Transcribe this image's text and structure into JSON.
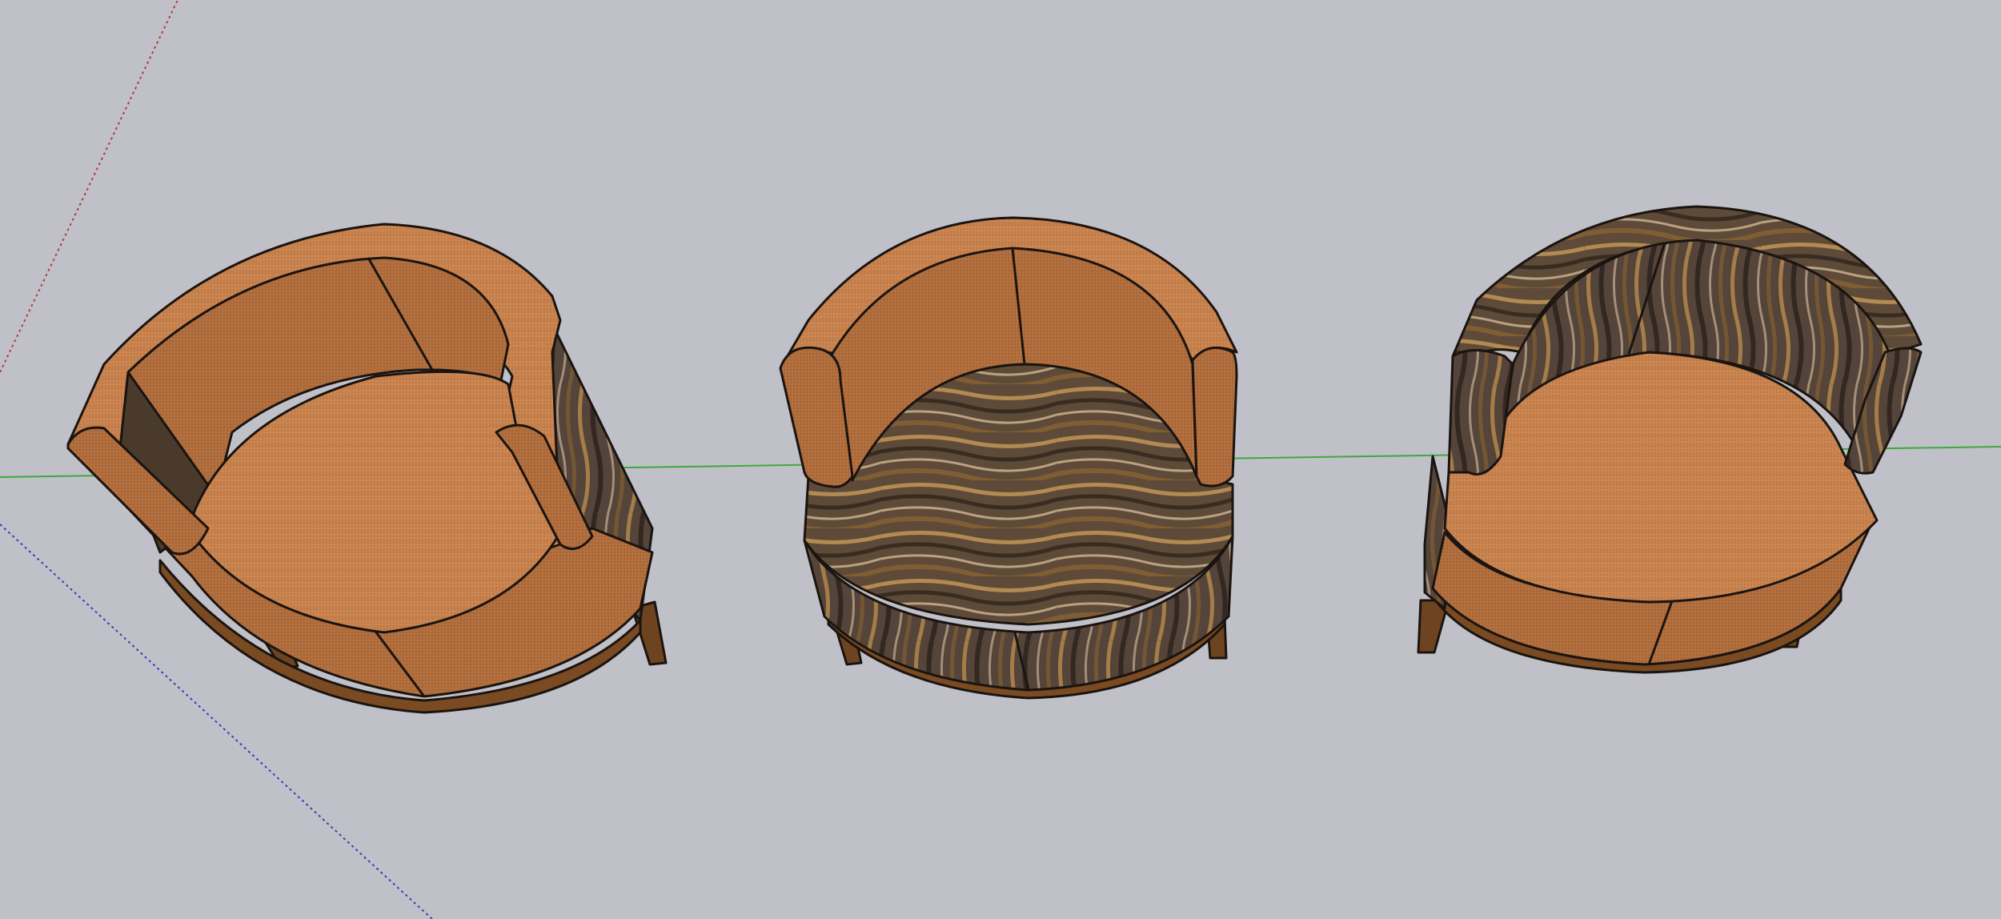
{
  "scene": {
    "background": "#c0c0c8",
    "axes": {
      "red_axis_color": "#b43c3c",
      "green_axis_color": "#3caa3c",
      "blue_axis_color": "#3c3cb4"
    },
    "models": [
      {
        "id": "chair-1",
        "shell_material": "woven-fabric",
        "seat_material": "woven-fabric"
      },
      {
        "id": "chair-2",
        "shell_material": "woven-fabric",
        "seat_material": "wave-wood"
      },
      {
        "id": "chair-3",
        "shell_material": "wave-wood",
        "seat_material": "woven-fabric"
      }
    ],
    "colors": {
      "fabric": "#c8824e",
      "wood_dark": "#4a3a2c",
      "wood_mid": "#8a6a45",
      "outline": "#1a1410",
      "leg": "#6e4420"
    }
  }
}
